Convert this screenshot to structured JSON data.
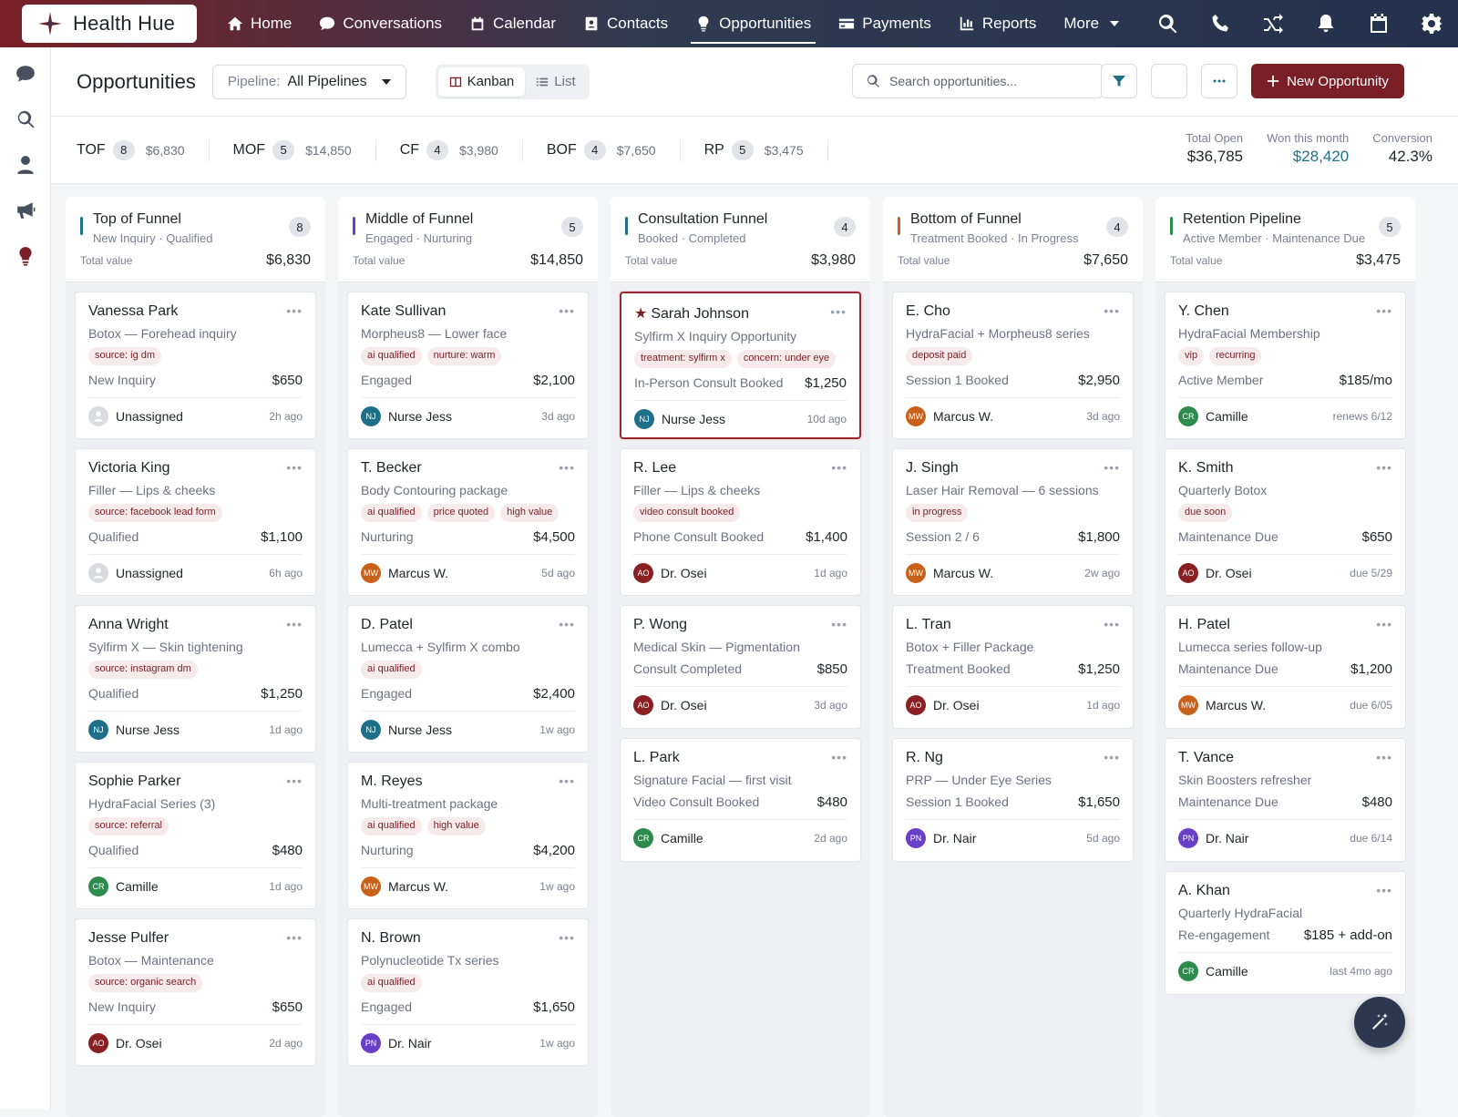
{
  "app": {
    "name": "Health Hue"
  },
  "nav": [
    {
      "label": "Home",
      "icon": "home-icon"
    },
    {
      "label": "Conversations",
      "icon": "chat-icon"
    },
    {
      "label": "Calendar",
      "icon": "calendar-icon"
    },
    {
      "label": "Contacts",
      "icon": "contacts-icon"
    },
    {
      "label": "Opportunities",
      "icon": "lightbulb-icon",
      "active": true
    },
    {
      "label": "Payments",
      "icon": "credit-card-icon"
    },
    {
      "label": "Reports",
      "icon": "bar-chart-icon"
    },
    {
      "label": "More",
      "icon": "chevron-down-icon"
    }
  ],
  "page": {
    "title": "Opportunities",
    "pipeline_label": "Pipeline:",
    "pipeline_value": "All Pipelines",
    "view_kanban": "Kanban",
    "view_list": "List",
    "search_placeholder": "Search opportunities...",
    "new_button": "New Opportunity"
  },
  "summary": {
    "stages": [
      {
        "code": "TOF",
        "count": "8",
        "amount": "$6,830"
      },
      {
        "code": "MOF",
        "count": "5",
        "amount": "$14,850"
      },
      {
        "code": "CF",
        "count": "4",
        "amount": "$3,980"
      },
      {
        "code": "BOF",
        "count": "4",
        "amount": "$7,650"
      },
      {
        "code": "RP",
        "count": "5",
        "amount": "$3,475"
      }
    ],
    "totals": [
      {
        "label": "Total Open",
        "value": "$36,785"
      },
      {
        "label": "Won this month",
        "value": "$28,420"
      },
      {
        "label": "Conversion",
        "value": "42.3%"
      }
    ]
  },
  "colors": {
    "brand": "#7a1f26",
    "nj": "#1d6f8a",
    "mw": "#c8621a",
    "ao": "#8a1f24",
    "cr": "#2e8b4e",
    "pn": "#6a3fc7",
    "bar_tof": "#1d6f8a",
    "bar_mof": "#6a3fc7",
    "bar_cf": "#1d6f8a",
    "bar_bof": "#c8621a",
    "bar_rp": "#2e8b4e"
  },
  "columns": [
    {
      "title": "Top of Funnel",
      "sub": "New Inquiry · Qualified",
      "count": "8",
      "total_label": "Total value",
      "total": "$6,830",
      "cards": [
        {
          "name": "Vanessa Park",
          "desc": "Botox — Forehead inquiry",
          "tags": [
            "source: ig dm"
          ],
          "status": "New Inquiry",
          "value": "$650",
          "owner": "Unassigned",
          "initials": "",
          "time": "2h ago"
        },
        {
          "name": "Victoria King",
          "desc": "Filler — Lips & cheeks",
          "tags": [
            "source: facebook lead form"
          ],
          "status": "Qualified",
          "value": "$1,100",
          "owner": "Unassigned",
          "initials": "",
          "time": "6h ago"
        },
        {
          "name": "Anna Wright",
          "desc": "Sylfirm X — Skin tightening",
          "tags": [
            "source: instagram dm"
          ],
          "status": "Qualified",
          "value": "$1,250",
          "owner": "Nurse Jess",
          "initials": "NJ",
          "time": "1d ago"
        },
        {
          "name": "Sophie Parker",
          "desc": "HydraFacial Series (3)",
          "tags": [
            "source: referral"
          ],
          "status": "Qualified",
          "value": "$480",
          "owner": "Camille",
          "initials": "CR",
          "time": "1d ago"
        },
        {
          "name": "Jesse Pulfer",
          "desc": "Botox — Maintenance",
          "tags": [
            "source: organic search"
          ],
          "status": "New Inquiry",
          "value": "$650",
          "owner": "Dr. Osei",
          "initials": "AO",
          "time": "2d ago"
        }
      ]
    },
    {
      "title": "Middle of Funnel",
      "sub": "Engaged · Nurturing",
      "count": "5",
      "total_label": "Total value",
      "total": "$14,850",
      "cards": [
        {
          "name": "Kate Sullivan",
          "desc": "Morpheus8 — Lower face",
          "tags": [
            "ai qualified",
            "nurture: warm"
          ],
          "status": "Engaged",
          "value": "$2,100",
          "owner": "Nurse Jess",
          "initials": "NJ",
          "time": "3d ago"
        },
        {
          "name": "T. Becker",
          "desc": "Body Contouring package",
          "tags": [
            "ai qualified",
            "price quoted",
            "high value"
          ],
          "status": "Nurturing",
          "value": "$4,500",
          "owner": "Marcus W.",
          "initials": "MW",
          "time": "5d ago"
        },
        {
          "name": "D. Patel",
          "desc": "Lumecca + Sylfirm X combo",
          "tags": [
            "ai qualified"
          ],
          "status": "Engaged",
          "value": "$2,400",
          "owner": "Nurse Jess",
          "initials": "NJ",
          "time": "1w ago"
        },
        {
          "name": "M. Reyes",
          "desc": "Multi-treatment package",
          "tags": [
            "ai qualified",
            "high value"
          ],
          "status": "Nurturing",
          "value": "$4,200",
          "owner": "Marcus W.",
          "initials": "MW",
          "time": "1w ago"
        },
        {
          "name": "N. Brown",
          "desc": "Polynucleotide Tx series",
          "tags": [
            "ai qualified"
          ],
          "status": "Engaged",
          "value": "$1,650",
          "owner": "Dr. Nair",
          "initials": "PN",
          "time": "1w ago"
        }
      ]
    },
    {
      "title": "Consultation Funnel",
      "sub": "Booked · Completed",
      "count": "4",
      "total_label": "Total value",
      "total": "$3,980",
      "cards": [
        {
          "name": "Sarah Johnson",
          "star": true,
          "desc": "Sylfirm X Inquiry Opportunity",
          "tags": [
            "treatment: sylfirm x",
            "concern: under eye"
          ],
          "status": "In-Person Consult Booked",
          "value": "$1,250",
          "owner": "Nurse Jess",
          "initials": "NJ",
          "time": "10d ago"
        },
        {
          "name": "R. Lee",
          "desc": "Filler — Lips & cheeks",
          "tags": [
            "video consult booked"
          ],
          "status": "Phone Consult Booked",
          "value": "$1,400",
          "owner": "Dr. Osei",
          "initials": "AO",
          "time": "1d ago"
        },
        {
          "name": "P. Wong",
          "desc": "Medical Skin — Pigmentation",
          "tags": [],
          "status": "Consult Completed",
          "value": "$850",
          "owner": "Dr. Osei",
          "initials": "AO",
          "time": "3d ago"
        },
        {
          "name": "L. Park",
          "desc": "Signature Facial — first visit",
          "tags": [],
          "status": "Video Consult Booked",
          "value": "$480",
          "owner": "Camille",
          "initials": "CR",
          "time": "2d ago"
        }
      ]
    },
    {
      "title": "Bottom of Funnel",
      "sub": "Treatment Booked · In Progress",
      "count": "4",
      "total_label": "Total value",
      "total": "$7,650",
      "cards": [
        {
          "name": "E. Cho",
          "desc": "HydraFacial + Morpheus8 series",
          "tags": [
            "deposit paid"
          ],
          "status": "Session 1 Booked",
          "value": "$2,950",
          "owner": "Marcus W.",
          "initials": "MW",
          "time": "3d ago"
        },
        {
          "name": "J. Singh",
          "desc": "Laser Hair Removal — 6 sessions",
          "tags": [
            "in progress"
          ],
          "status": "Session 2 / 6",
          "value": "$1,800",
          "owner": "Marcus W.",
          "initials": "MW",
          "time": "2w ago"
        },
        {
          "name": "L. Tran",
          "desc": "Botox + Filler Package",
          "tags": [],
          "status": "Treatment Booked",
          "value": "$1,250",
          "owner": "Dr. Osei",
          "initials": "AO",
          "time": "1d ago"
        },
        {
          "name": "R. Ng",
          "desc": "PRP — Under Eye Series",
          "tags": [],
          "status": "Session 1 Booked",
          "value": "$1,650",
          "owner": "Dr. Nair",
          "initials": "PN",
          "time": "5d ago"
        }
      ]
    },
    {
      "title": "Retention Pipeline",
      "sub": "Active Member · Maintenance Due",
      "count": "5",
      "total_label": "Total value",
      "total": "$3,475",
      "cards": [
        {
          "name": "Y. Chen",
          "desc": "HydraFacial Membership",
          "tags": [
            "vip",
            "recurring"
          ],
          "status": "Active Member",
          "value": "$185/mo",
          "owner": "Camille",
          "initials": "CR",
          "time": "renews 6/12"
        },
        {
          "name": "K. Smith",
          "desc": "Quarterly Botox",
          "tags": [
            "due soon"
          ],
          "status": "Maintenance Due",
          "value": "$650",
          "owner": "Dr. Osei",
          "initials": "AO",
          "time": "due 5/29"
        },
        {
          "name": "H. Patel",
          "desc": "Lumecca series follow-up",
          "tags": [],
          "status": "Maintenance Due",
          "value": "$1,200",
          "owner": "Marcus W.",
          "initials": "MW",
          "time": "due 6/05"
        },
        {
          "name": "T. Vance",
          "desc": "Skin Boosters refresher",
          "tags": [],
          "status": "Maintenance Due",
          "value": "$480",
          "owner": "Dr. Nair",
          "initials": "PN",
          "time": "due 6/14"
        },
        {
          "name": "A. Khan",
          "desc": "Quarterly HydraFacial",
          "tags": [],
          "status": "Re-engagement",
          "value": "$185 + add-on",
          "owner": "Camille",
          "initials": "CR",
          "time": "last 4mo ago"
        }
      ]
    }
  ]
}
